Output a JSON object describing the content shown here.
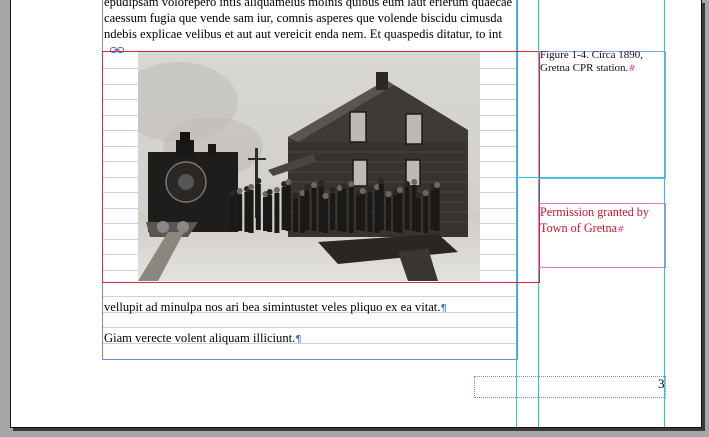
{
  "body_text": {
    "line1": "epudipsam volorepero intis aliquamelus molnis quibus eum laut erierum quaecae",
    "line2": "caessum fugia que vende sam iur, comnis asperes que volende biscidu cimusda",
    "line3": "ndebis explicae velibus et aut aut vereicit enda nem. Et quaspedis ditatur, to int",
    "para2": "vellupit ad minulpa nos ari bea simintustet veles pliquo ex ea vitat.",
    "para3": "Giam verecte volent aliquam illiciunt."
  },
  "figure": {
    "caption": "Figure 1-4. Circa 1890, Gretna CPR station.",
    "credit_line1": "Permission granted by",
    "credit_line2": "Town of Gretna"
  },
  "markers": {
    "pilcrow": "¶",
    "hash": "#"
  },
  "page_number": "3",
  "colors": {
    "guide": "#1ad0d7",
    "frame": "#6e8fe0",
    "selected_frame": "#d3283f",
    "credit_text": "#c8162e",
    "pasteboard": "#a6a6a6"
  }
}
